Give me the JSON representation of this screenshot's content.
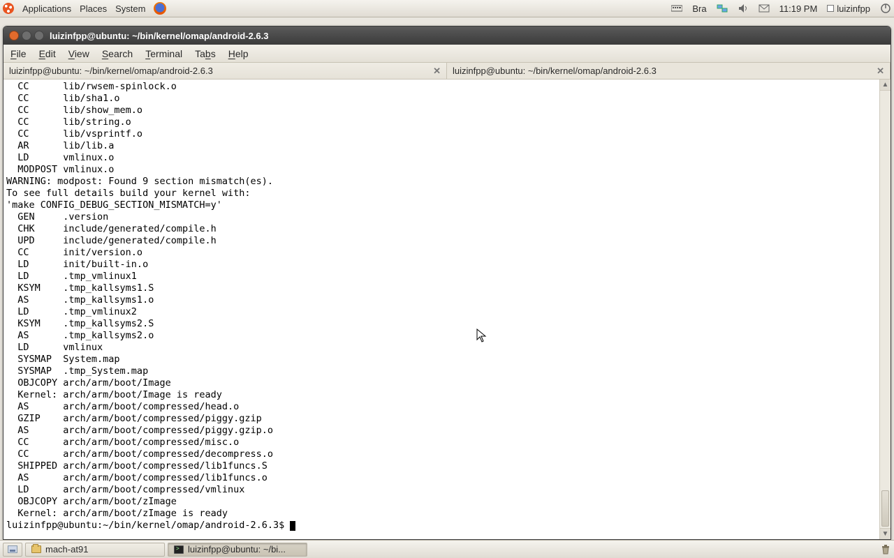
{
  "top_panel": {
    "menu": {
      "applications": "Applications",
      "places": "Places",
      "system": "System"
    },
    "kb_layout": "Bra",
    "clock": "11:19 PM",
    "user": "luizinfpp"
  },
  "window": {
    "title": "luizinfpp@ubuntu: ~/bin/kernel/omap/android-2.6.3",
    "menubar": {
      "file": "File",
      "edit": "Edit",
      "view": "View",
      "search": "Search",
      "terminal": "Terminal",
      "tabs": "Tabs",
      "help": "Help"
    },
    "tabs": [
      {
        "label": "luizinfpp@ubuntu: ~/bin/kernel/omap/android-2.6.3"
      },
      {
        "label": "luizinfpp@ubuntu: ~/bin/kernel/omap/android-2.6.3"
      }
    ],
    "terminal_lines": [
      "  CC      lib/rwsem-spinlock.o",
      "  CC      lib/sha1.o",
      "  CC      lib/show_mem.o",
      "  CC      lib/string.o",
      "  CC      lib/vsprintf.o",
      "  AR      lib/lib.a",
      "  LD      vmlinux.o",
      "  MODPOST vmlinux.o",
      "WARNING: modpost: Found 9 section mismatch(es).",
      "To see full details build your kernel with:",
      "'make CONFIG_DEBUG_SECTION_MISMATCH=y'",
      "  GEN     .version",
      "  CHK     include/generated/compile.h",
      "  UPD     include/generated/compile.h",
      "  CC      init/version.o",
      "  LD      init/built-in.o",
      "  LD      .tmp_vmlinux1",
      "  KSYM    .tmp_kallsyms1.S",
      "  AS      .tmp_kallsyms1.o",
      "  LD      .tmp_vmlinux2",
      "  KSYM    .tmp_kallsyms2.S",
      "  AS      .tmp_kallsyms2.o",
      "  LD      vmlinux",
      "  SYSMAP  System.map",
      "  SYSMAP  .tmp_System.map",
      "  OBJCOPY arch/arm/boot/Image",
      "  Kernel: arch/arm/boot/Image is ready",
      "  AS      arch/arm/boot/compressed/head.o",
      "  GZIP    arch/arm/boot/compressed/piggy.gzip",
      "  AS      arch/arm/boot/compressed/piggy.gzip.o",
      "  CC      arch/arm/boot/compressed/misc.o",
      "  CC      arch/arm/boot/compressed/decompress.o",
      "  SHIPPED arch/arm/boot/compressed/lib1funcs.S",
      "  AS      arch/arm/boot/compressed/lib1funcs.o",
      "  LD      arch/arm/boot/compressed/vmlinux",
      "  OBJCOPY arch/arm/boot/zImage",
      "  Kernel: arch/arm/boot/zImage is ready"
    ],
    "prompt": "luizinfpp@ubuntu:~/bin/kernel/omap/android-2.6.3$ "
  },
  "bottom_panel": {
    "task1": "mach-at91",
    "task2": "luizinfpp@ubuntu: ~/bi..."
  }
}
